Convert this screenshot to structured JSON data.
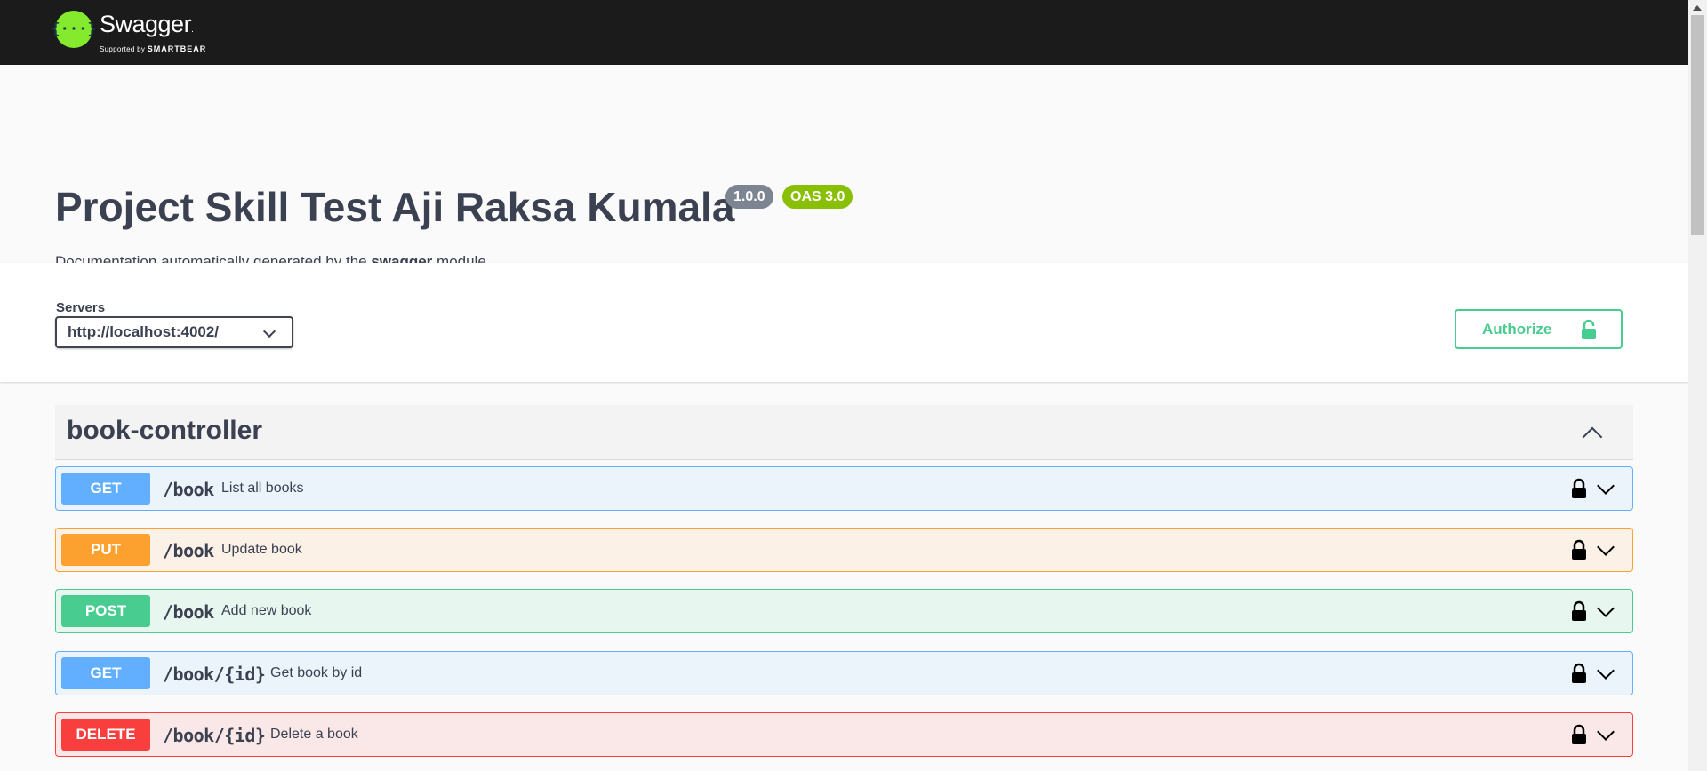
{
  "topbar": {
    "logo_symbol": "{···}",
    "logo_name": "Swagger",
    "logo_tm": ".",
    "logo_supported": "Supported by",
    "logo_company": "SMARTBEAR"
  },
  "info": {
    "title": "Project Skill Test Aji Raksa Kumala",
    "version": "1.0.0",
    "oas": "OAS 3.0",
    "description_prefix": "Documentation automatically generated by the ",
    "description_bold": "swagger",
    "description_suffix": " module."
  },
  "servers": {
    "label": "Servers",
    "selected": "http://localhost:4002/"
  },
  "authorize": {
    "label": "Authorize",
    "icon": "unlock-icon"
  },
  "tag": {
    "name": "book-controller",
    "icon": "chevron-up-icon"
  },
  "operations": [
    {
      "method": "GET",
      "path": "/book",
      "summary": "List all books",
      "color": "#61affe"
    },
    {
      "method": "PUT",
      "path": "/book",
      "summary": "Update book",
      "color": "#fca130"
    },
    {
      "method": "POST",
      "path": "/book",
      "summary": "Add new book",
      "color": "#49cc90"
    },
    {
      "method": "GET",
      "path": "/book/{id}",
      "summary": "Get book by id",
      "color": "#61affe"
    },
    {
      "method": "DELETE",
      "path": "/book/{id}",
      "summary": "Delete a book",
      "color": "#f93e3e"
    }
  ],
  "colors": {
    "topbar": "#1b1b1b",
    "brand_green": "#85ea2d",
    "version_badge": "#7d8492",
    "oas_badge": "#89bf04",
    "authorize": "#49cc90"
  }
}
